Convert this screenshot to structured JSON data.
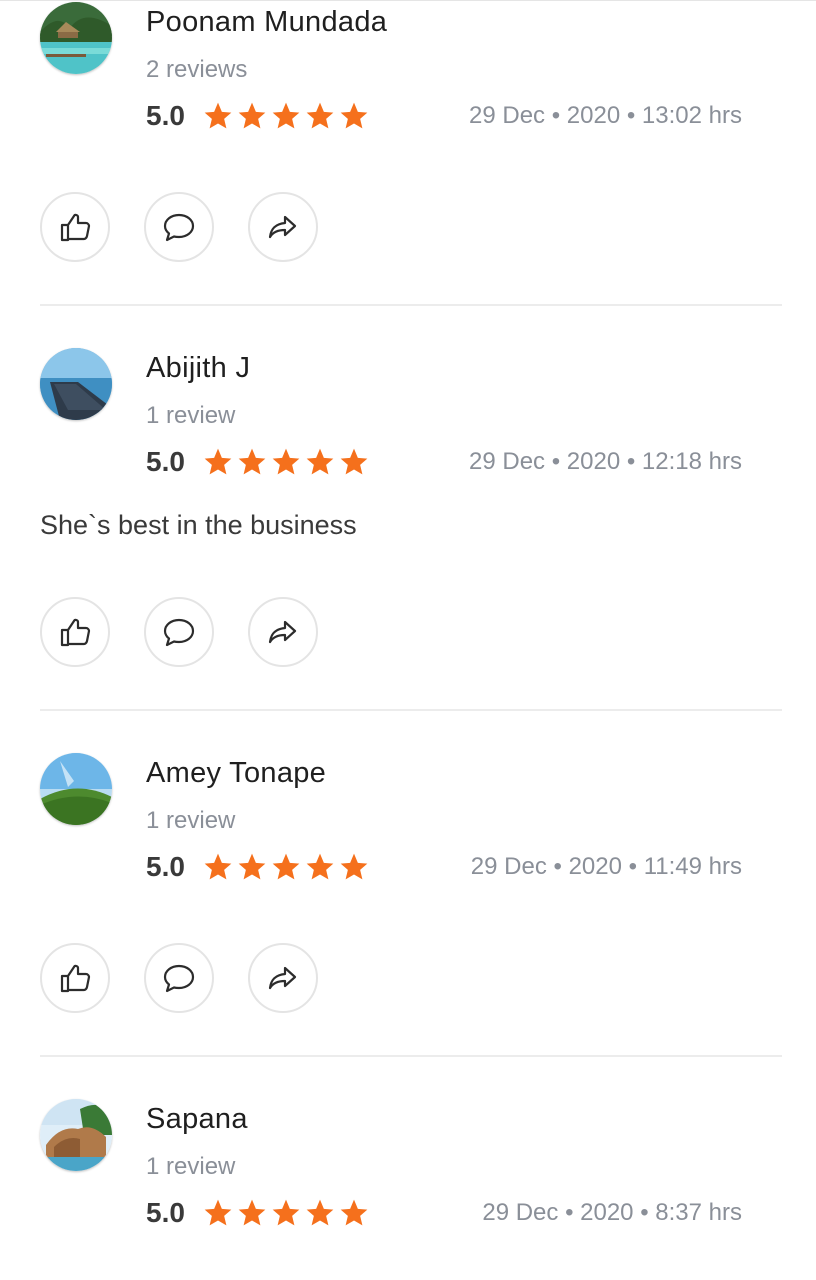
{
  "colors": {
    "star": "#f5701c",
    "muted_text": "#8a8f98",
    "divider": "#ececec"
  },
  "reviews": [
    {
      "avatar_icon": "beach-resort-photo",
      "name": "Poonam Mundada",
      "review_count": "2 reviews",
      "score": "5.0",
      "stars": 5,
      "date": "29 Dec • 2020 • 13:02 hrs",
      "comment": ""
    },
    {
      "avatar_icon": "ocean-pier-photo",
      "name": "Abijith J",
      "review_count": "1 review",
      "score": "5.0",
      "stars": 5,
      "date": "29 Dec • 2020 • 12:18 hrs",
      "comment": "She`s best in the business"
    },
    {
      "avatar_icon": "green-hill-photo",
      "name": "Amey Tonape",
      "review_count": "1 review",
      "score": "5.0",
      "stars": 5,
      "date": "29 Dec • 2020 • 11:49 hrs",
      "comment": ""
    },
    {
      "avatar_icon": "coastal-rocks-photo",
      "name": "Sapana",
      "review_count": "1 review",
      "score": "5.0",
      "stars": 5,
      "date": "29 Dec • 2020 • 8:37 hrs",
      "comment": ""
    }
  ],
  "actions": [
    {
      "icon": "thumbs-up-icon"
    },
    {
      "icon": "comment-icon"
    },
    {
      "icon": "share-icon"
    }
  ]
}
